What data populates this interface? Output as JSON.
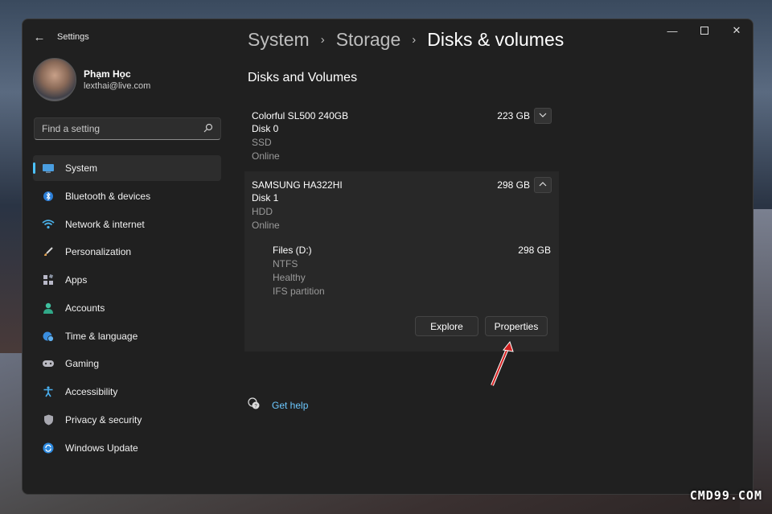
{
  "app": {
    "title": "Settings"
  },
  "profile": {
    "name": "Phạm Học",
    "email": "lexthai@live.com"
  },
  "search": {
    "placeholder": "Find a setting"
  },
  "nav": {
    "items": [
      {
        "label": "System",
        "icon": "monitor-icon",
        "active": true
      },
      {
        "label": "Bluetooth & devices",
        "icon": "bluetooth-icon"
      },
      {
        "label": "Network & internet",
        "icon": "wifi-icon"
      },
      {
        "label": "Personalization",
        "icon": "brush-icon"
      },
      {
        "label": "Apps",
        "icon": "apps-icon"
      },
      {
        "label": "Accounts",
        "icon": "person-icon"
      },
      {
        "label": "Time & language",
        "icon": "globe-clock-icon"
      },
      {
        "label": "Gaming",
        "icon": "gamepad-icon"
      },
      {
        "label": "Accessibility",
        "icon": "accessibility-icon"
      },
      {
        "label": "Privacy & security",
        "icon": "shield-icon"
      },
      {
        "label": "Windows Update",
        "icon": "update-icon"
      }
    ]
  },
  "breadcrumb": {
    "system": "System",
    "storage": "Storage",
    "current": "Disks & volumes"
  },
  "section_title": "Disks and Volumes",
  "disks": [
    {
      "name": "Colorful SL500 240GB",
      "size": "223 GB",
      "number": "Disk 0",
      "type": "SSD",
      "status": "Online"
    },
    {
      "name": "SAMSUNG HA322HI",
      "size": "298 GB",
      "number": "Disk 1",
      "type": "HDD",
      "status": "Online"
    }
  ],
  "partition": {
    "name": "Files (D:)",
    "size": "298 GB",
    "fs": "NTFS",
    "health": "Healthy",
    "kind": "IFS partition"
  },
  "buttons": {
    "explore": "Explore",
    "properties": "Properties"
  },
  "help": {
    "label": "Get help"
  },
  "watermark": "CMD99.COM",
  "colors": {
    "accent": "#4cc2ff",
    "link": "#6cc8ff",
    "window_bg": "#202020",
    "annotation_arrow": "#d42020"
  }
}
